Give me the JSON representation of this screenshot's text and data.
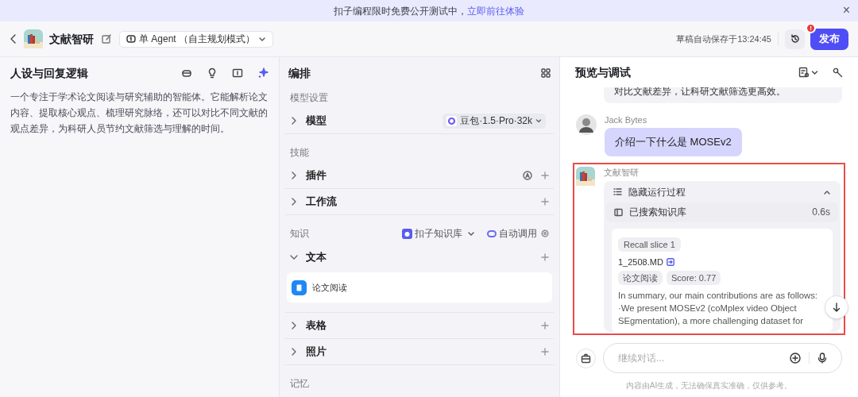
{
  "banner": {
    "text": "扣子编程限时免费公开测试中，",
    "link": "立即前往体验",
    "close": "×"
  },
  "header": {
    "title": "文献智研",
    "mode": "单 Agent （自主规划模式）",
    "autosave": "草稿自动保存于13:24:45",
    "publish": "发布",
    "badge": "!"
  },
  "persona": {
    "title": "人设与回复逻辑",
    "text": "一个专注于学术论文阅读与研究辅助的智能体。它能解析论文内容、提取核心观点、梳理研究脉络，还可以对比不同文献的观点差异，为科研人员节约文献筛选与理解的时间。"
  },
  "arrange": {
    "title": "编排",
    "sections": [
      {
        "heading": "模型设置",
        "rows": [
          {
            "kind": "model",
            "label": "模型",
            "expanded": false,
            "value": "豆包·1.5·Pro·32k"
          }
        ]
      },
      {
        "heading": "技能",
        "rows": [
          {
            "kind": "plugin",
            "label": "插件",
            "expanded": false
          },
          {
            "kind": "plain",
            "label": "工作流",
            "expanded": false
          }
        ]
      },
      {
        "heading": "知识",
        "source": "扣子知识库",
        "auto": "自动调用",
        "rows": [
          {
            "kind": "plain",
            "label": "文本",
            "expanded": true,
            "files": [
              "论文阅读"
            ]
          },
          {
            "kind": "plain",
            "label": "表格",
            "expanded": false
          },
          {
            "kind": "plain",
            "label": "照片",
            "expanded": false
          }
        ]
      },
      {
        "heading": "记忆"
      }
    ]
  },
  "preview": {
    "title": "预览与调试",
    "messages": [
      {
        "kind": "bot_tail",
        "text": "对比文献差异，让科研文献筛选更高效。"
      },
      {
        "kind": "user",
        "author": "Jack Bytes",
        "text": "介绍一下什么是 MOSEv2"
      },
      {
        "kind": "bot",
        "author": "文献智研",
        "process": {
          "toggle": "隐藏运行过程",
          "expanded": true,
          "step": "已搜索知识库",
          "time": "0.6s",
          "slice": {
            "label": "Recall slice 1",
            "file": "1_2508.MD",
            "tags": [
              "论文阅读",
              "Score: 0.77"
            ],
            "text": "In summary, our main contributions are as follows:\n·We present MOSEv2 (coMplex video Object SEgmentation), a more challenging dataset for"
          }
        }
      }
    ],
    "input": {
      "placeholder": "继续对话..."
    },
    "disclaimer": "内容由AI生成，无法确保真实准确，仅供参考。"
  }
}
